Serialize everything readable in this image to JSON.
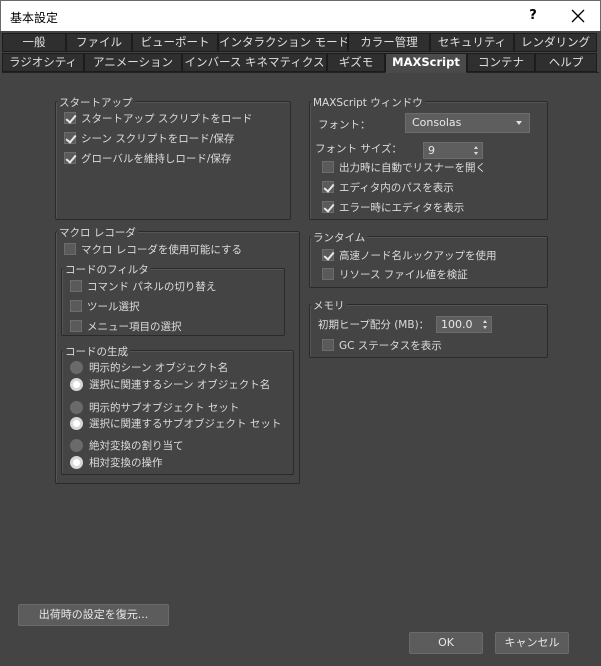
{
  "window": {
    "title": "基本設定",
    "help_label": "?"
  },
  "tabs_row1": [
    "一般",
    "ファイル",
    "ビューポート",
    "インタラクション モード",
    "カラー管理",
    "セキュリティ",
    "レンダリング"
  ],
  "tabs_row2": [
    "ラジオシティ",
    "アニメーション",
    "インバース キネマティクス",
    "ギズモ",
    "MAXScript",
    "コンテナ",
    "ヘルプ"
  ],
  "active_tab": "MAXScript",
  "startup": {
    "title": "スタートアップ",
    "items": [
      {
        "label": "スタートアップ スクリプトをロード",
        "checked": true
      },
      {
        "label": "シーン スクリプトをロード/保存",
        "checked": true
      },
      {
        "label": "グローバルを維持しロード/保存",
        "checked": true
      }
    ]
  },
  "macro_recorder": {
    "title": "マクロ レコーダ",
    "enable": {
      "label": "マクロ レコーダを使用可能にする",
      "checked": false
    },
    "code_filter": {
      "title": "コードのフィルタ",
      "items": [
        {
          "label": "コマンド パネルの切り替え",
          "checked": false
        },
        {
          "label": "ツール選択",
          "checked": false
        },
        {
          "label": "メニュー項目の選択",
          "checked": false
        }
      ]
    },
    "code_generation": {
      "title": "コードの生成",
      "options": [
        {
          "label": "明示的シーン オブジェクト名",
          "selected": false
        },
        {
          "label": "選択に関連するシーン オブジェクト名",
          "selected": true
        },
        {
          "label": "明示的サブオブジェクト セット",
          "selected": false
        },
        {
          "label": "選択に関連するサブオブジェクト セット",
          "selected": true
        },
        {
          "label": "絶対変換の割り当て",
          "selected": false
        },
        {
          "label": "相対変換の操作",
          "selected": true
        }
      ]
    }
  },
  "maxscript_window": {
    "title": "MAXScript ウィンドウ",
    "font_label": "フォント：",
    "font_value": "Consolas",
    "font_size_label": "フォント サイズ：",
    "font_size_value": "9",
    "items": [
      {
        "label": "出力時に自動でリスナーを開く",
        "checked": false
      },
      {
        "label": "エディタ内のパスを表示",
        "checked": true
      },
      {
        "label": "エラー時にエディタを表示",
        "checked": true
      }
    ]
  },
  "runtime": {
    "title": "ランタイム",
    "items": [
      {
        "label": "高速ノード名ルックアップを使用",
        "checked": true
      },
      {
        "label": "リソース ファイル値を検証",
        "checked": false
      }
    ]
  },
  "memory": {
    "title": "メモリ",
    "heap_label": "初期ヒープ配分 (MB)：",
    "heap_value": "100.0",
    "gc_label": "GC ステータスを表示",
    "gc_checked": false
  },
  "buttons": {
    "restore": "出荷時の設定を復元...",
    "ok": "OK",
    "cancel": "キャンセル"
  }
}
